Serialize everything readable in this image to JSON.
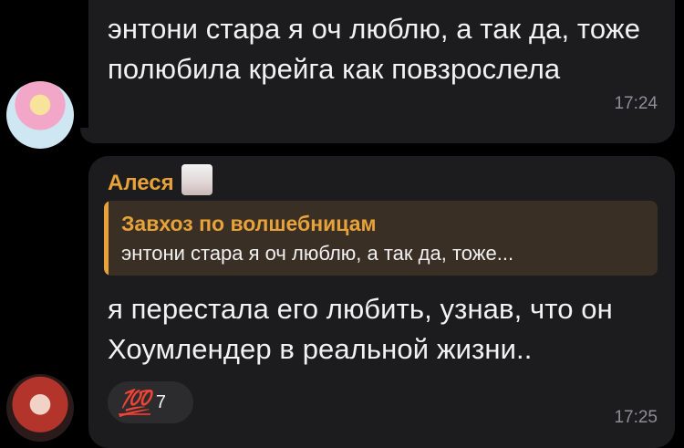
{
  "messages": [
    {
      "text": "энтони стара я оч люблю, а так да, тоже полюбила крейга как повзрослела",
      "time": "17:24"
    },
    {
      "sender": "Алеся",
      "reply": {
        "author": "Завхоз по волшебницам",
        "text": "энтони стара я оч люблю, а так да, тоже..."
      },
      "text": "я перестала его любить, узнав, что он Хоумлендер в реальной жизни..",
      "reaction": {
        "emoji": "💯",
        "count": "7"
      },
      "time": "17:25"
    }
  ],
  "colors": {
    "accent": "#e7a23a",
    "bubble": "#1c1c1e",
    "reply_bg": "#3a2f25"
  }
}
